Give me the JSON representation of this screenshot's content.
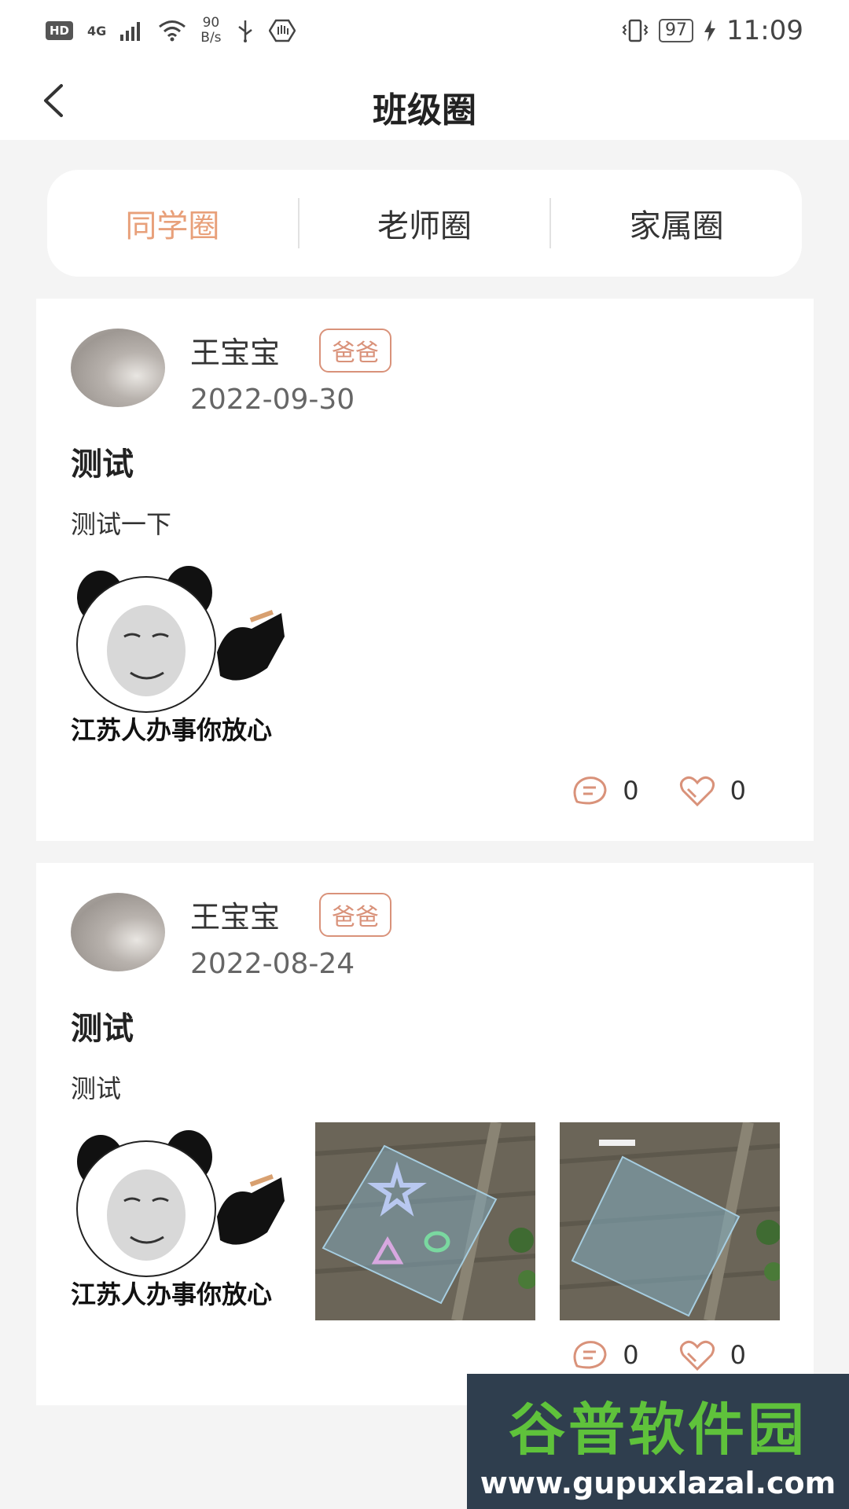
{
  "status_bar": {
    "hd": "HD",
    "network": "4G",
    "speed_value": "90",
    "speed_unit": "B/s",
    "battery": "97",
    "time": "11:09"
  },
  "header": {
    "title": "班级圈"
  },
  "tabs": [
    {
      "label": "同学圈",
      "active": true
    },
    {
      "label": "老师圈",
      "active": false
    },
    {
      "label": "家属圈",
      "active": false
    }
  ],
  "posts": [
    {
      "author": "王宝宝",
      "role": "爸爸",
      "date": "2022-09-30",
      "title": "测试",
      "body": "测试一下",
      "images": [
        {
          "kind": "meme",
          "caption": "江苏人办事你放心"
        }
      ],
      "comments": "0",
      "likes": "0"
    },
    {
      "author": "王宝宝",
      "role": "爸爸",
      "date": "2022-08-24",
      "title": "测试",
      "body": "测试",
      "images": [
        {
          "kind": "meme",
          "caption": "江苏人办事你放心"
        },
        {
          "kind": "aerial-shapes"
        },
        {
          "kind": "aerial-field"
        }
      ],
      "comments": "0",
      "likes": "0"
    }
  ],
  "watermark": {
    "name": "谷普软件园",
    "url": "www.gupuxlazal.com"
  },
  "colors": {
    "accent": "#e8a07a",
    "badge": "#d9927a",
    "background": "#f4f4f4"
  }
}
